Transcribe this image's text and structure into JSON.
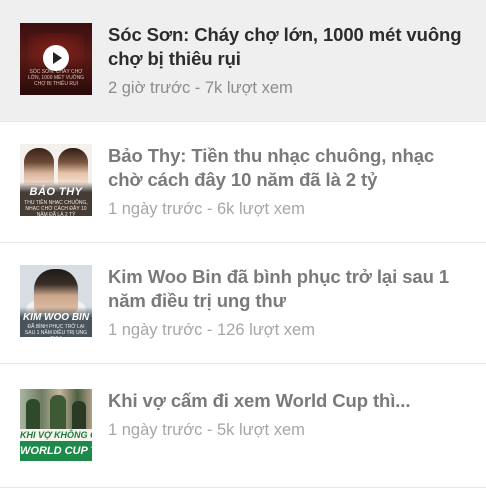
{
  "articles": [
    {
      "title": "Sóc Sơn: Cháy chợ lớn, 1000 mét vuông chợ bị thiêu rụi",
      "meta": "2 giờ trước - 7k lượt xem",
      "thumb_caption": "SÓC SƠN: CHÁY CHỢ LỚN, 1000 MÉT VUÔNG CHỢ BỊ THIÊU RỤI",
      "selected": true,
      "has_video": true
    },
    {
      "title": "Bảo Thy: Tiền thu nhạc chuông, nhạc chờ cách đây 10 năm đã là 2 tỷ",
      "meta": "1 ngày trước - 6k lượt xem",
      "thumb_title": "BẢO THY",
      "thumb_caption": "THU TIỀN NHẠC CHUÔNG, NHẠC CHỜ CÁCH ĐÂY 10 NĂM ĐÃ LÀ 2 TỶ"
    },
    {
      "title": "Kim Woo Bin đã bình phục trở lại sau 1 năm điều trị ung thư",
      "meta": "1 ngày trước - 126 lượt xem",
      "thumb_title": "KIM WOO BIN",
      "thumb_caption": "ĐÃ BÌNH PHỤC TRỞ LẠI SAU 1 NĂM ĐIỀU TRỊ UNG THƯ"
    },
    {
      "title": "Khi vợ cấm đi xem World Cup thì...",
      "meta": "1 ngày trước - 5k lượt xem",
      "thumb_line1": "KHI VỢ KHÔNG CHO ĐI XEM",
      "thumb_line2": "WORLD CUP THÌ..."
    }
  ],
  "colors": {
    "selected_bg": "#efefef",
    "title_active": "#2c2c2c",
    "title_inactive": "#7a7a7a",
    "meta": "#a6a6a6"
  }
}
